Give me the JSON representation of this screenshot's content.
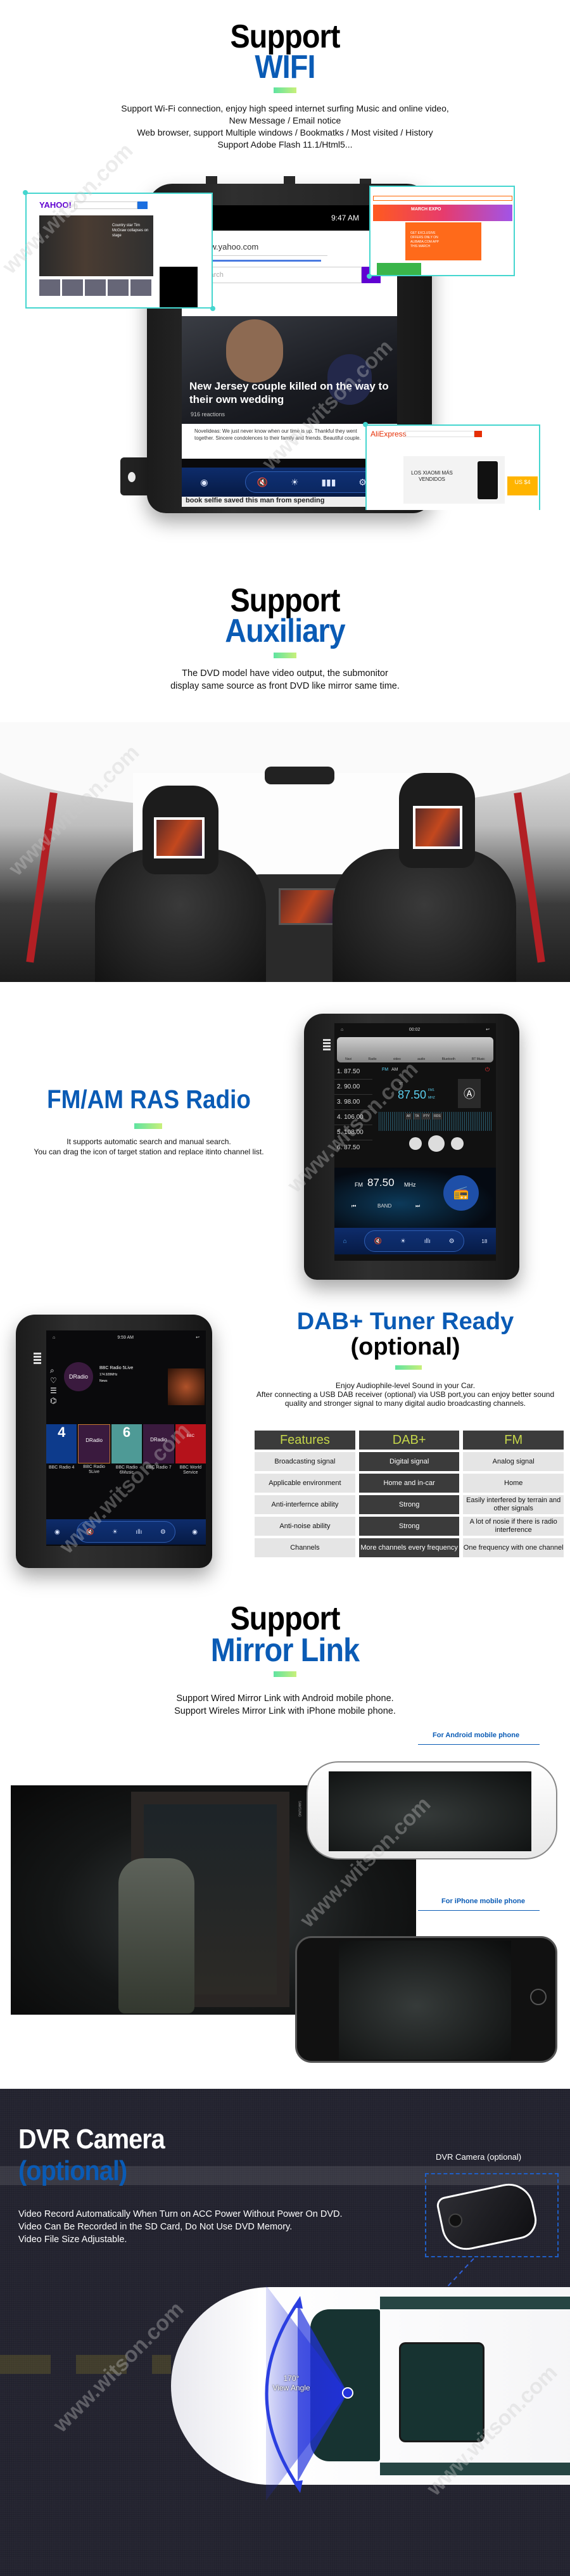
{
  "watermark": "www.witson.com",
  "colors": {
    "accent_blue": "#0a5bb5",
    "highlight_cyan": "#45d6cf",
    "table_header_text": "#c5d64a",
    "dvr_bg": "#22222e"
  },
  "wifi": {
    "title_line1": "Support",
    "title_line2": "WIFI",
    "description": [
      "Support Wi-Fi connection, enjoy high speed internet surfing Music and online video,",
      "New Message / Email notice",
      "Web browser, support Multiple windows / Bookmatks / Most visited / History",
      "Support Adobe Flash 11.1/Html5..."
    ],
    "screen": {
      "time": "9:47 AM",
      "url": "ps://www.yahoo.com",
      "search_placeholder": "Search",
      "headline": "New Jersey couple killed on the way to their own wedding",
      "reactions": "916 reactions",
      "comment": "Novelideas: We just never know when our time is up. Thankful they went together. Sincere condolences to their family and friends. Beautiful couple.",
      "next_headline": "book selfie saved this man from spending"
    },
    "overlays": {
      "yahoo_logo": "YAHOO!",
      "yahoo_story": "Country star Tim McGraw collapses on stage",
      "alibaba_banner": "MARCH EXPO",
      "alibaba_promo": "GET EXCLUSIVE OFFERS ONLY ON ALIBABA.COM APP THIS MARCH",
      "aliexpress_logo": "AliExpress",
      "aliexpress_promo": "LOS XIAOMI MÁS VENDIDOS",
      "aliexpress_price": "US $4"
    }
  },
  "auxiliary": {
    "title_line1": "Support",
    "title_line2": "Auxiliary",
    "description": [
      "The DVD model have video output, the submonitor",
      "display same source as front DVD like mirror same time."
    ]
  },
  "radio": {
    "title": "FM/AM RAS Radio",
    "description": [
      "It supports automatic search and manual search.",
      "You can drag the icon of target station and replace itinto channel list."
    ],
    "screen": {
      "time": "00:02",
      "apps": [
        "Navi",
        "Radio",
        "video",
        "audio",
        "Bluetooth",
        "BT Music"
      ],
      "presets": [
        "1.  87.50",
        "2.  90.00",
        "3.  98.00",
        "4.  106.00",
        "5.  108.00",
        "6.  87.50"
      ],
      "bands": [
        "FM",
        "AM"
      ],
      "st": "ST",
      "frequency": "87.50",
      "band_label": "FM1",
      "unit": "MHZ",
      "rds_buttons": [
        "AF",
        "TA",
        "PTY",
        "RDS"
      ],
      "widget_band": "FM",
      "widget_frequency": "87.50",
      "widget_unit": "MHz",
      "widget_band_button": "BAND",
      "volume": "18"
    }
  },
  "dab": {
    "title_line1": "DAB+ Tuner Ready",
    "title_line2": "(optional)",
    "description": [
      "Enjoy Audiophile-level Sound in your Car.",
      "After connecting a USB DAB receiver (optional) via USB port,you can enjoy better sound",
      "quality and stronger signal to many digital audio broadcasting channels."
    ],
    "screen": {
      "time": "9:59 AM",
      "station": "BBC Radio 5Live",
      "frequency": "174.928MHz",
      "genre": "News",
      "logo_text": "DRadio",
      "stations": [
        "BBC Radio 4",
        "BBC Radio 5Live",
        "BBC Radio 6Music",
        "BBC Radio 7",
        "BBC World Service"
      ]
    },
    "table": {
      "headers": [
        "Features",
        "DAB+",
        "FM"
      ],
      "rows": [
        [
          "Broadcasting signal",
          "Digital signal",
          "Analog signal"
        ],
        [
          "Applicable environment",
          "Home and in-car",
          "Home"
        ],
        [
          "Anti-interfernce ability",
          "Strong",
          "Easily interfered by terrain and other signals"
        ],
        [
          "Anti-noise ability",
          "Strong",
          "A lot of nosie if there is radio interference"
        ],
        [
          "Channels",
          "More channels every frequency",
          "One frequency with one channel"
        ]
      ]
    }
  },
  "mirror": {
    "title_line1": "Support",
    "title_line2": "Mirror Link",
    "description": [
      "Support Wired Mirror Link with Android mobile phone.",
      "Support Wireles Mirror Link with iPhone mobile phone."
    ],
    "android_label": "For Android mobile phone",
    "iphone_label": "For iPhone mobile phone",
    "phone_brand": "SAMSUNG"
  },
  "dvr": {
    "title_line1": "DVR Camera",
    "title_line2": "(optional)",
    "description": [
      "Video Record Automatically When Turn on ACC Power Without Power On DVD.",
      "Video Can Be Recorded in the SD Card, Do Not Use DVD Memory.",
      "Video File Size Adjustable."
    ],
    "camera_label": "DVR Camera (optional)",
    "angle": "170°",
    "angle_label": "View Angle"
  }
}
